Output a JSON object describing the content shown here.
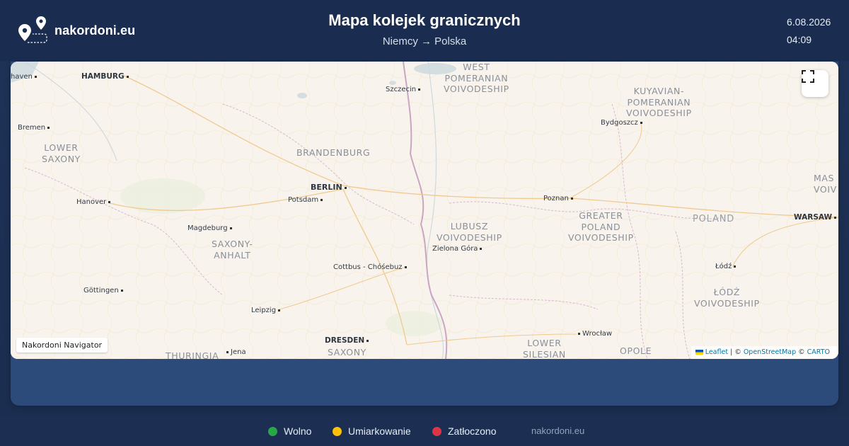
{
  "header": {
    "logo_text": "nakordoni.eu",
    "title": "Mapa kolejek granicznych",
    "subtitle": "Niemcy → Polska",
    "date": "6.08.2026",
    "time": "04:09"
  },
  "map": {
    "nav_badge": "Nakordoni Navigator",
    "attribution": {
      "leaflet": "Leaflet",
      "sep1": " | © ",
      "osm": "OpenStreetMap",
      "sep2": " © ",
      "carto": "CARTO"
    },
    "fullscreen_icon": "expand-icon",
    "cities": {
      "bremerhaven": "haven",
      "hamburg": "HAMBURG",
      "bremen": "Bremen",
      "szczecin": "Szczecin",
      "bydgoszcz": "Bydgoszcz",
      "berlin": "BERLIN",
      "potsdam": "Potsdam",
      "hanover": "Hanover",
      "poznan": "Poznan",
      "warsaw": "WARSAW",
      "magdeburg": "Magdeburg",
      "zielona_gora": "Zielona Góra",
      "cottbus": "Cottbus - Chóśebuz",
      "lodz": "Łódź",
      "gottingen": "Göttingen",
      "leipzig": "Leipzig",
      "wroclaw": "Wrocław",
      "dresden": "DRESDEN",
      "jena": "Jena"
    },
    "regions": {
      "west_pomeranian": [
        "WEST",
        "POMERANIAN",
        "VOIVODESHIP"
      ],
      "kuyavian": [
        "KUYAVIAN-",
        "POMERANIAN",
        "VOIVODESHIP"
      ],
      "lower_saxony": [
        "LOWER",
        "SAXONY"
      ],
      "brandenburg": [
        "BRANDENBURG"
      ],
      "masovian": [
        "MAS",
        "VOIV"
      ],
      "lubusz": [
        "LUBUSZ",
        "VOIVODESHIP"
      ],
      "greater_poland": [
        "GREATER",
        "POLAND",
        "VOIVODESHIP"
      ],
      "saxony_anhalt": [
        "SAXONY-",
        "ANHALT"
      ],
      "lodz_voiv": [
        "ŁÓDŹ",
        "VOIVODESHIP"
      ],
      "saxony": [
        "SAXONY"
      ],
      "lower_silesian": [
        "LOWER",
        "SILESIAN"
      ],
      "opole": [
        "OPOLE"
      ],
      "thuringia": [
        "THURINGIA"
      ]
    },
    "countries": {
      "poland": "POLAND"
    }
  },
  "legend": [
    {
      "label": "Wolno",
      "color": "#28a745"
    },
    {
      "label": "Umiarkowanie",
      "color": "#ffc107"
    },
    {
      "label": "Zatłoczono",
      "color": "#dc3545"
    }
  ],
  "footer": {
    "site": "nakordoni.eu"
  }
}
